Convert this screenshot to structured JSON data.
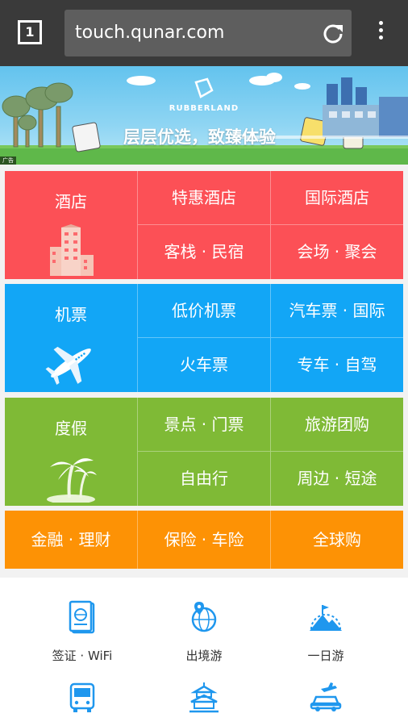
{
  "browser": {
    "tab_count": "1",
    "url": "touch.qunar.com"
  },
  "banner": {
    "brand": "RUBBERLAND",
    "slogan": "层层优选，致臻体验",
    "ad_label": "广告"
  },
  "categories": {
    "hotel": {
      "main": "酒店",
      "items": [
        "特惠酒店",
        "国际酒店",
        "客栈 · 民宿",
        "会场 · 聚会"
      ]
    },
    "flight": {
      "main": "机票",
      "items": [
        "低价机票",
        "汽车票 · 国际",
        "火车票",
        "专车 · 自驾"
      ]
    },
    "vacation": {
      "main": "度假",
      "items": [
        "景点 · 门票",
        "旅游团购",
        "自由行",
        "周边 · 短途"
      ]
    },
    "finance": {
      "items": [
        "金融 · 理财",
        "保险 · 车险",
        "全球购"
      ]
    }
  },
  "quick_links": [
    {
      "label": "签证 · WiFi",
      "icon": "passport-icon"
    },
    {
      "label": "出境游",
      "icon": "globe-pin-icon"
    },
    {
      "label": "一日游",
      "icon": "mountain-flag-icon"
    },
    {
      "label": "",
      "icon": "bus-icon"
    },
    {
      "label": "",
      "icon": "temple-icon"
    },
    {
      "label": "",
      "icon": "plane-car-icon"
    }
  ],
  "colors": {
    "hotel": "#fc5056",
    "flight": "#12a6f6",
    "vacation": "#7fba36",
    "finance": "#fd9205",
    "icon_blue": "#1f97ee"
  }
}
